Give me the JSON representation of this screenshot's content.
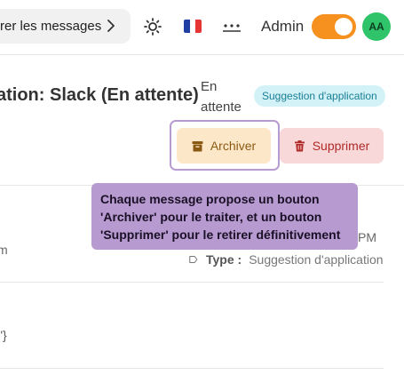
{
  "topbar": {
    "filter_label": "rer les messages",
    "language_flag": "french-flag",
    "user_label": "Admin",
    "avatar_initials": "AA",
    "toggle_on": true
  },
  "message": {
    "title": "ation: Slack (En attente)",
    "status_text": "En attente",
    "badge": "Suggestion d'application",
    "archive_label": "Archiver",
    "delete_label": "Supprimer",
    "time_fragment": "PM",
    "sender_fragment": "m",
    "type_label": "Type :",
    "type_value": "Suggestion d'application",
    "content_fragment": "\"}"
  },
  "tooltip": {
    "text": "Chaque message propose un bouton 'Archiver' pour le traiter, et un bouton 'Supprimer' pour le retirer définitivement"
  },
  "colors": {
    "accent_orange": "#f6901e",
    "avatar_green": "#2fc46a",
    "badge_bg": "#d2f2f7",
    "archive_bg": "#fde7c9",
    "delete_bg": "#f8d8d8",
    "tooltip_bg": "#b79bd0"
  }
}
